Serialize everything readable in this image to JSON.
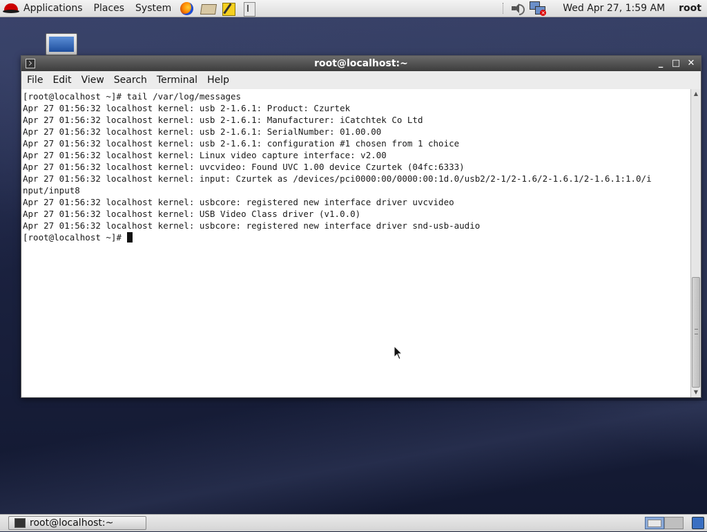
{
  "top_panel": {
    "menus": [
      "Applications",
      "Places",
      "System"
    ],
    "clock": "Wed Apr 27,  1:59 AM",
    "user": "root"
  },
  "window": {
    "title": "root@localhost:~",
    "menu": [
      "File",
      "Edit",
      "View",
      "Search",
      "Terminal",
      "Help"
    ],
    "terminal_lines": [
      "[root@localhost ~]# tail /var/log/messages",
      "Apr 27 01:56:32 localhost kernel: usb 2-1.6.1: Product: Czurtek",
      "Apr 27 01:56:32 localhost kernel: usb 2-1.6.1: Manufacturer: iCatchtek Co Ltd",
      "Apr 27 01:56:32 localhost kernel: usb 2-1.6.1: SerialNumber: 01.00.00",
      "Apr 27 01:56:32 localhost kernel: usb 2-1.6.1: configuration #1 chosen from 1 choice",
      "Apr 27 01:56:32 localhost kernel: Linux video capture interface: v2.00",
      "Apr 27 01:56:32 localhost kernel: uvcvideo: Found UVC 1.00 device Czurtek (04fc:6333)",
      "Apr 27 01:56:32 localhost kernel: input: Czurtek as /devices/pci0000:00/0000:00:1d.0/usb2/2-1/2-1.6/2-1.6.1/2-1.6.1:1.0/i",
      "nput/input8",
      "Apr 27 01:56:32 localhost kernel: usbcore: registered new interface driver uvcvideo",
      "Apr 27 01:56:32 localhost kernel: USB Video Class driver (v1.0.0)",
      "Apr 27 01:56:32 localhost kernel: usbcore: registered new interface driver snd-usb-audio"
    ],
    "prompt": "[root@localhost ~]# "
  },
  "bottom_panel": {
    "task_label": "root@localhost:~"
  }
}
